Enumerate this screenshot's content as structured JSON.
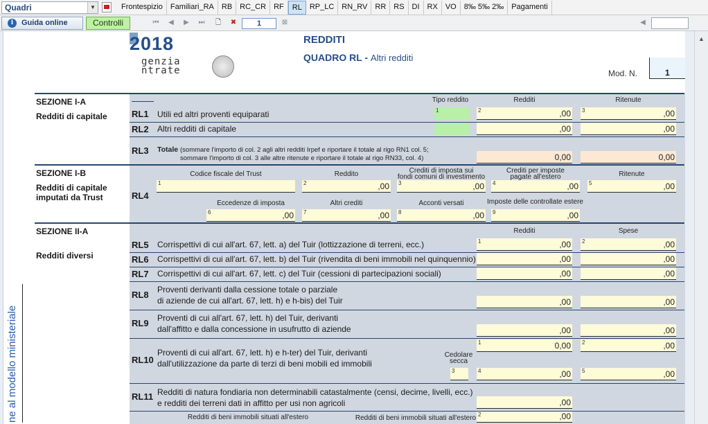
{
  "toolbar": {
    "quadri_select": "Quadri",
    "tabs": [
      "Frontespizio",
      "Familiari_RA",
      "RB",
      "RC_CR",
      "RF",
      "RL",
      "RP_LC",
      "RN_RV",
      "RR",
      "RS",
      "DI",
      "RX",
      "VO",
      "8‰ 5‰ 2‰",
      "Pagamenti"
    ],
    "active_tab": "RL",
    "guida": "Guida online",
    "controlli": "Controlli",
    "page": "1"
  },
  "colors": {
    "accent": "#264e8c",
    "field": "#fdfbd8",
    "field_total": "#fde8d4",
    "field_green": "#b8f0a8",
    "grey": "#d1d7e0"
  },
  "header": {
    "year": "2018",
    "agency_line1": "genzia",
    "agency_line2": "ntrate",
    "title": "REDDITI",
    "quadro_bold": "QUADRO RL - ",
    "quadro_rest": "Altri redditi",
    "modn_label": "Mod. N.",
    "modn_value": "1"
  },
  "side_text": "ne al modello ministeriale",
  "sections": {
    "s1a_title": "SEZIONE I-A",
    "s1a_sub": "Redditi di capitale",
    "s1b_title": "SEZIONE I-B",
    "s1b_sub": "Redditi di capitale imputati da Trust",
    "s2a_title": "SEZIONE II-A",
    "s2a_sub": "Redditi diversi"
  },
  "s1a": {
    "h_tipo": "Tipo reddito",
    "h_redditi": "Redditi",
    "h_ritenute": "Ritenute",
    "rl1_code": "RL1",
    "rl1_desc": "Utili ed altri proventi equiparati",
    "rl2_code": "RL2",
    "rl2_desc": "Altri redditi di capitale",
    "rl3_code": "RL3",
    "rl3_bold": "Totale",
    "rl3_l1": "(sommare l'importo di col. 2 agli altri redditi Irpef e riportare il totale al rigo RN1 col. 5;",
    "rl3_l2": "sommare l'importo di col. 3 alle altre ritenute e riportare il totale al rigo RN33, col. 4)",
    "zero": ",00",
    "zero_total": "0,00"
  },
  "s1b": {
    "rl4_code": "RL4",
    "h_cf": "Codice fiscale del Trust",
    "h_reddito": "Reddito",
    "h_crediti1": "Crediti di imposta sui",
    "h_crediti2": "fondi comuni di investimento",
    "h_estero1": "Crediti per imposte",
    "h_estero2": "pagate all'estero",
    "h_ritenute": "Ritenute",
    "h_eccedenze": "Eccedenze di imposta",
    "h_altri": "Altri crediti",
    "h_acconti": "Acconti versati",
    "h_controllate": "Imposte delle controllate estere"
  },
  "s2a": {
    "h_redditi": "Redditi",
    "h_spese": "Spese",
    "rl5_code": "RL5",
    "rl5_desc": "Corrispettivi di cui all'art. 67, lett. a) del Tuir (lottizzazione di terreni, ecc.)",
    "rl6_code": "RL6",
    "rl6_desc": "Corrispettivi di cui all'art. 67, lett. b) del Tuir (rivendita di beni immobili nel quinquennio)",
    "rl7_code": "RL7",
    "rl7_desc": "Corrispettivi di cui all'art. 67, lett. c) del Tuir (cessioni di partecipazioni sociali)",
    "rl8_code": "RL8",
    "rl8_l1": "Proventi derivanti dalla cessione totale o parziale",
    "rl8_l2": "di aziende de cui all'art. 67, lett. h) e h-bis) del Tuir",
    "rl9_code": "RL9",
    "rl9_l1": "Proventi di cui all'art. 67, lett. h) del Tuir, derivanti",
    "rl9_l2": "dall'affitto e dalla concessione in usufrutto di aziende",
    "rl10_code": "RL10",
    "rl10_l1": "Proventi di cui all'art. 67, lett. h) e h-ter) del Tuir, derivanti",
    "rl10_l2": "dall'utilizzazione da parte di terzi di beni mobili ed immobili",
    "h_cedolare1": "Cedolare",
    "h_cedolare2": "secca",
    "rl11_code": "RL11",
    "rl11_l1": "Redditi di natura fondiaria non determinabili catastalmente (censi, decime, livelli, ecc.)",
    "rl11_l2": "e redditi dei terreni dati in affitto per usi non agricoli",
    "h_estero_a": "Redditi di beni immobili situati all'estero",
    "h_estero_b": "Redditi di beni immobili situati all'estero",
    "zero": ",00",
    "zero_total": "0,00"
  }
}
